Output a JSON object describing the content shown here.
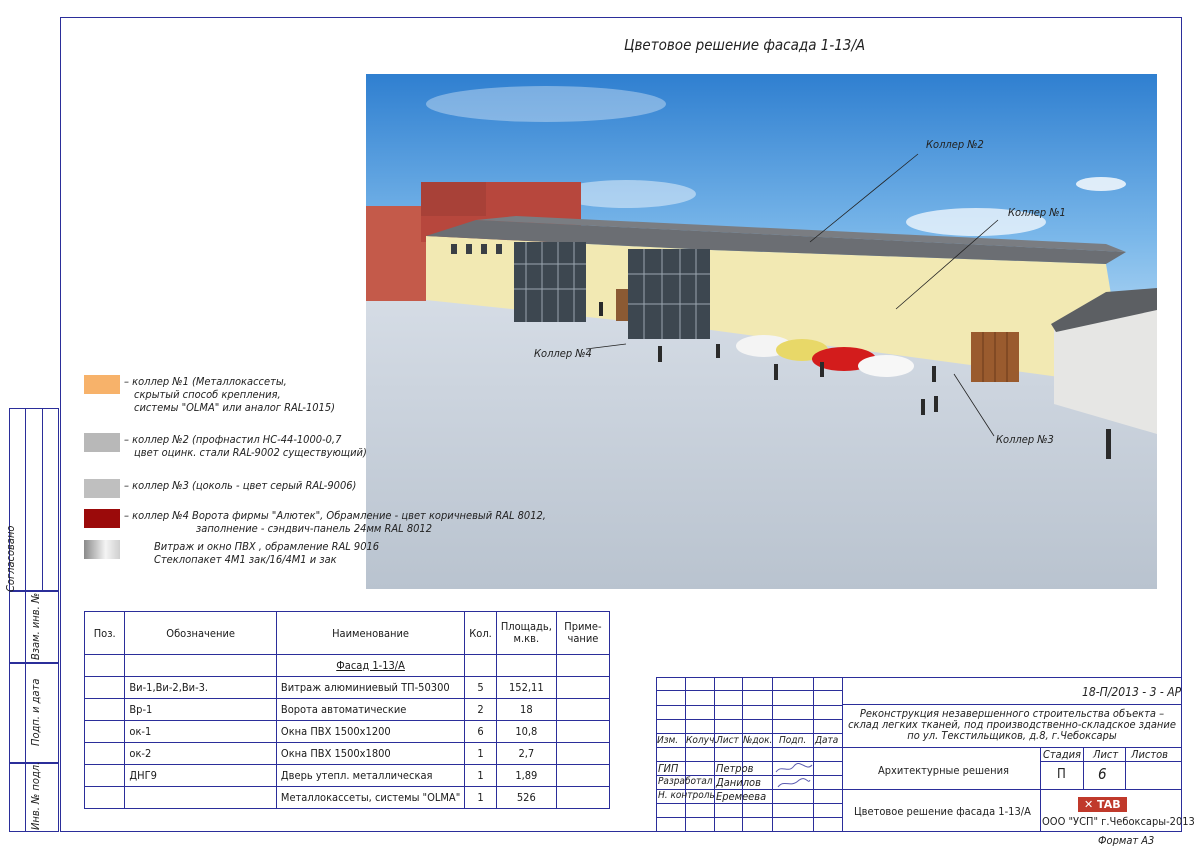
{
  "title": "Цветовое решение фасада 1-13/А",
  "callouts": {
    "c1": "Коллер №1",
    "c2": "Коллер №2",
    "c3": "Коллер №3",
    "c4": "Коллер №4"
  },
  "legend": [
    {
      "color": "#f7b26a",
      "lines": [
        "– коллер №1 (Металлокассеты,",
        "скрытый способ крепления,",
        "системы \"OLMA\" или аналог RAL-1015)"
      ]
    },
    {
      "color": "#b8b8b8",
      "lines": [
        "– коллер №2 (профнастил НС-44-1000-0,7",
        "цвет оцинк. стали RAL-9002 существующий)"
      ]
    },
    {
      "color": "#bfbfbf",
      "lines": [
        "– коллер №3 (цоколь - цвет серый RAL-9006)"
      ]
    },
    {
      "color": "#9b0a0a",
      "lines": [
        "– коллер №4 Ворота фирмы \"Алютек\", Обрамление - цвет коричневый RAL  8012,",
        "заполнение - сэндвич-панель 24мм RAL  8012"
      ]
    },
    {
      "color": "gradient",
      "lines": [
        "Витраж и окно ПВХ , обрамление RAL 9016",
        "Стеклопакет 4М1 зак/16/4М1 и зак"
      ]
    }
  ],
  "side": {
    "agreed": "Согласовано",
    "inv_replace": "Взам. инв. №",
    "sign_date": "Подп. и дата",
    "inv_orig": "Инв. № подл."
  },
  "table": {
    "headers": {
      "pos": "Поз.",
      "designation": "Обозначение",
      "name": "Наименование",
      "qty": "Кол.",
      "area": "Площадь, м.кв.",
      "note": "Приме- чание"
    },
    "section": "Фасад 1-13/А",
    "rows": [
      {
        "designation": "Ви-1,Ви-2,Ви-3.",
        "name": "Витраж алюминиевый ТП-50300",
        "qty": "5",
        "area": "152,11"
      },
      {
        "designation": "Вр-1",
        "name": "Ворота автоматические",
        "qty": "2",
        "area": "18"
      },
      {
        "designation": "ок-1",
        "name": "Окна ПВХ    1500х1200",
        "qty": "6",
        "area": "10,8"
      },
      {
        "designation": "ок-2",
        "name": "Окна ПВХ    1500х1800",
        "qty": "1",
        "area": "2,7"
      },
      {
        "designation": "ДНГ9",
        "name": "Дверь утепл. металлическая",
        "qty": "1",
        "area": "1,89"
      },
      {
        "designation": "",
        "name": "Металлокассеты, системы \"OLMA\"",
        "qty": "1",
        "area": "526"
      }
    ]
  },
  "stamp": {
    "code": "18-П/2013 - 3 - АР",
    "project": [
      "Реконструкция незавершенного строительства объекта –",
      "склад легких тканей, под производственно-складское здание",
      "по ул. Текстильщиков, д.8, г.Чебоксары"
    ],
    "cols": {
      "izm": "Изм.",
      "kol": "Колуч.",
      "list": "Лист",
      "ndoc": "№док.",
      "podp": "Подп.",
      "date": "Дата"
    },
    "roles": [
      {
        "role": "ГИП",
        "name": "Петров"
      },
      {
        "role": "Разработал",
        "name": "Данилов"
      },
      {
        "role": "Н. контроль",
        "name": "Еремеева"
      }
    ],
    "section": "Архитектурные решения",
    "stage_label": "Стадия",
    "sheet_label": "Лист",
    "sheets_label": "Листов",
    "stage": "П",
    "sheet": "6",
    "drawing": "Цветовое решение фасада 1-13/А",
    "company": "ООО \"УСП\" г.Чебоксары-2013",
    "logo": "TAB",
    "format": "Формат   А3"
  }
}
